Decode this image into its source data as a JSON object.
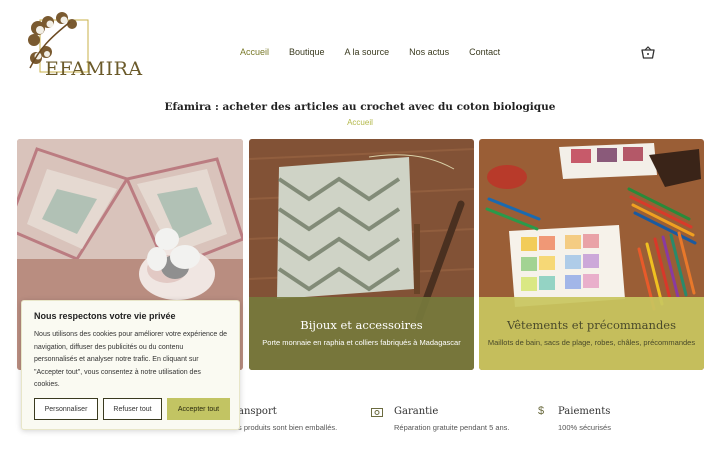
{
  "header": {
    "logo_text": "EFAMIRA",
    "nav": [
      {
        "label": "Accueil",
        "active": true
      },
      {
        "label": "Boutique"
      },
      {
        "label": "A la source"
      },
      {
        "label": "Nos actus"
      },
      {
        "label": "Contact"
      }
    ],
    "cart_icon": "basket-icon"
  },
  "page": {
    "title": "Efamira : acheter des articles au crochet avec du coton biologique",
    "breadcrumb": "Accueil"
  },
  "cards": [
    {
      "title": "",
      "subtitle": ""
    },
    {
      "title": "Bijoux et accessoires",
      "subtitle": "Porte monnaie en raphia et colliers fabriqués à Madagascar"
    },
    {
      "title": "Vêtements et précommandes",
      "subtitle": "Maillots de bain, sacs de plage, robes, châles, précommandes"
    }
  ],
  "features": [
    {
      "title": "ansport",
      "desc": "s produits sont bien emballés.",
      "icon": "truck-icon"
    },
    {
      "title": "Garantie",
      "desc": "Réparation gratuite pendant 5 ans.",
      "icon": "money-icon"
    },
    {
      "title": "Paiements",
      "desc": "100% sécurisés",
      "icon": "dollar-icon"
    }
  ],
  "cookie": {
    "title": "Nous respectons votre vie privée",
    "text": "Nous utilisons des cookies pour améliorer votre expérience de navigation, diffuser des publicités ou du contenu personnalisés et analyser notre trafic. En cliquant sur \"Accepter tout\", vous consentez à notre utilisation des cookies.",
    "btn_customize": "Personnaliser",
    "btn_refuse": "Refuser tout",
    "btn_accept": "Accepter tout"
  },
  "colors": {
    "accent": "#c2c463",
    "olive": "#767a3c",
    "nav_active": "#7a7a2a"
  }
}
